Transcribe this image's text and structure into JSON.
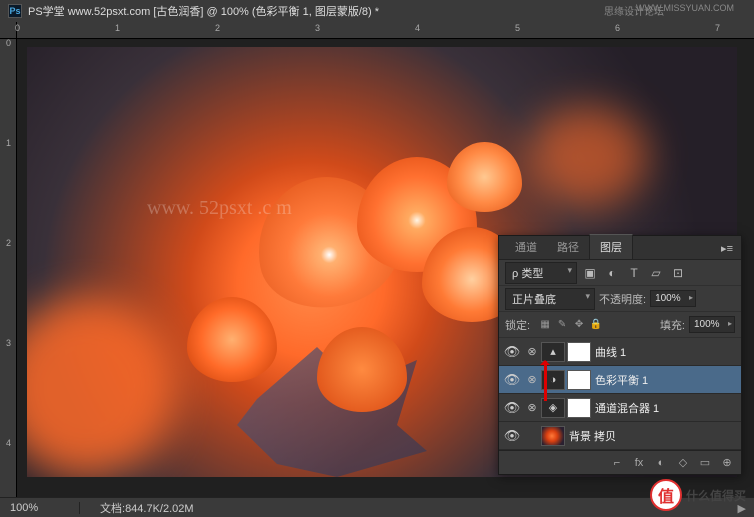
{
  "title": {
    "app": "Ps",
    "text": "PS学堂  www.52psxt.com [古色润香] @ 100% (色彩平衡 1, 图层蒙版/8) *"
  },
  "top_labels": {
    "l1": "思缘设计论坛",
    "l2": "WWW.MISSYUAN.COM"
  },
  "ruler_h": [
    "0",
    "",
    "1",
    "",
    "2",
    "",
    "3",
    "",
    "4",
    "",
    "5",
    "",
    "6",
    "",
    "7"
  ],
  "ruler_v": [
    "0",
    "",
    "1",
    "",
    "2",
    "",
    "3",
    "",
    "4"
  ],
  "status": {
    "zoom": "100%",
    "doc_label": "文档:",
    "doc": "844.7K/2.02M",
    "arrow": "▶"
  },
  "watermark": "www. 52psxt .c m",
  "panel": {
    "tabs": [
      "通道",
      "路径",
      "图层"
    ],
    "menu": "▸≡",
    "filter": {
      "search": "ρ",
      "type": "类型"
    },
    "filter_icons": [
      "▣",
      "◐",
      "T",
      "▱",
      "⊡"
    ],
    "blend": {
      "mode": "正片叠底",
      "opacity_label": "不透明度:",
      "opacity": "100%"
    },
    "lock": {
      "label": "锁定:",
      "fill_label": "填充:",
      "fill": "100%"
    },
    "lock_icons": [
      "▦",
      "✎",
      "✥",
      "🔒"
    ],
    "layers": [
      {
        "eye": "👁",
        "link": "⊗",
        "adj": "▴",
        "name": "曲线 1",
        "sel": false
      },
      {
        "eye": "👁",
        "link": "⊗",
        "adj": "◑",
        "name": "色彩平衡 1",
        "sel": true
      },
      {
        "eye": "👁",
        "link": "⊗",
        "adj": "◈",
        "name": "通道混合器 1",
        "sel": false
      },
      {
        "eye": "👁",
        "link": "",
        "adj": "",
        "name": "背景 拷贝",
        "sel": false,
        "img": true
      }
    ],
    "footer": [
      "⌐",
      "fx",
      "◐",
      "◇",
      "▭",
      "⊕"
    ]
  },
  "badge": {
    "char": "值",
    "text": "什么值得买"
  }
}
